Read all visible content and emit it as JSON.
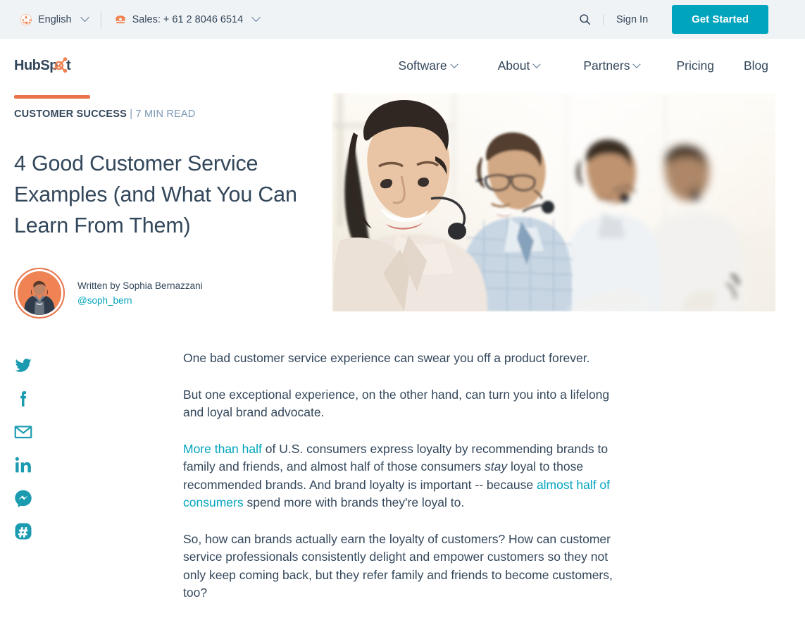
{
  "utility_bar": {
    "language": {
      "icon": "globe-icon",
      "label": "English"
    },
    "sales": {
      "icon": "phone-icon",
      "label": "Sales: + 61 2 8046 6514"
    },
    "search_icon": "search-icon",
    "sign_in": "Sign In",
    "get_started": "Get Started"
  },
  "nav": {
    "logo": "HubSpot",
    "links": [
      {
        "label": "Software",
        "has_caret": true
      },
      {
        "label": "About",
        "has_caret": true
      },
      {
        "label": "Partners",
        "has_caret": true
      },
      {
        "label": "Pricing",
        "has_caret": false
      },
      {
        "label": "Blog",
        "has_caret": false
      }
    ]
  },
  "article": {
    "category": "CUSTOMER SUCCESS",
    "read_time": "| 7 MIN READ",
    "title": "4 Good Customer Service Examples (and What You Can Learn From Them)",
    "author_line": "Written by Sophia Bernazzani",
    "author_handle": "@soph_bern",
    "hero_alt": "Four customer service representatives wearing headsets smiling in a bright office"
  },
  "share": {
    "items": [
      {
        "name": "twitter-icon",
        "label": "Twitter"
      },
      {
        "name": "facebook-icon",
        "label": "Facebook"
      },
      {
        "name": "email-icon",
        "label": "Email"
      },
      {
        "name": "linkedin-icon",
        "label": "LinkedIn"
      },
      {
        "name": "messenger-icon",
        "label": "Messenger"
      },
      {
        "name": "hashtag-icon",
        "label": "Hashtag"
      }
    ]
  },
  "body": {
    "p1": "One bad customer service experience can swear you off a product forever.",
    "p2": "But one exceptional experience, on the other hand, can turn you into a lifelong and loyal brand advocate.",
    "p3": {
      "link1": "More than half",
      "part1": " of U.S. consumers express loyalty by recommending brands to family and friends, and almost half of those consumers ",
      "italic": "stay",
      "part2": " loyal to those recommended brands. And brand loyalty is important -- because ",
      "link2": "almost half of consumers",
      "part3": " spend more with brands they're loyal to."
    },
    "p4": "So, how can brands actually earn the loyalty of customers? How can customer service professionals consistently delight and empower customers so they not only keep coming back, but they refer family and friends to become customers, too?"
  },
  "colors": {
    "teal": "#00a4bd",
    "orange": "#e8734a",
    "text": "#33475b",
    "muted": "#7c98b6",
    "utility_bg": "#f0f3f5"
  }
}
